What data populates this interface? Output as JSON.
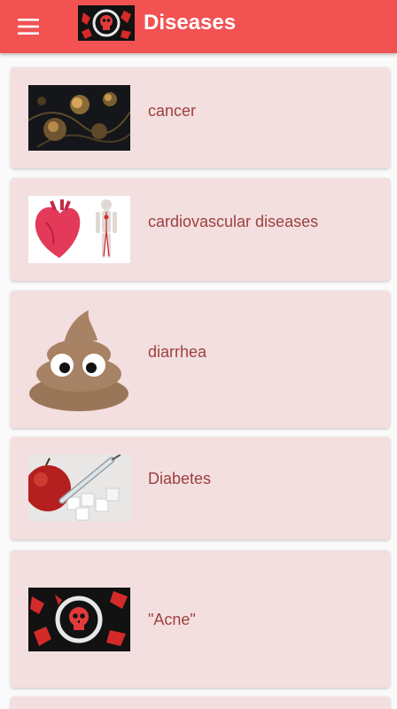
{
  "app": {
    "title": "Diseases",
    "accent_color": "#f25252",
    "menu_icon": "hamburger-menu-icon",
    "logo": "skull-logo"
  },
  "diseases": [
    {
      "name": "cancer",
      "image": "cancer-cells-image"
    },
    {
      "name": "cardiovascular diseases",
      "image": "heart-body-image"
    },
    {
      "name": "diarrhea",
      "image": "poop-emoji-image"
    },
    {
      "name": "Diabetes",
      "image": "apple-syringe-sugar-image"
    },
    {
      "name": "\"Acne\"",
      "image": "skull-logo-image"
    }
  ]
}
